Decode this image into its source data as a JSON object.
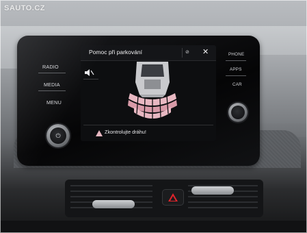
{
  "watermark": {
    "text": "SAUTO.CZ"
  },
  "side_buttons": {
    "left": [
      "RADIO",
      "MEDIA",
      "MENU"
    ],
    "right": [
      "PHONE",
      "APPS",
      "CAR"
    ]
  },
  "display": {
    "title": "Pomoc při parkování",
    "close_glyph": "✕",
    "hide_glyph": "⊘",
    "left_icon_glyph": "🔉",
    "warning": "Zkontrolujte dráhu!",
    "colors": {
      "screen_bg": "#0d0e10",
      "sensor_fill": "#e8b8c2",
      "warning_triangle": "#e8b8c2"
    }
  },
  "knobs": {
    "left_glyph": "⏻"
  },
  "hazard": {
    "color": "#e0242b"
  }
}
